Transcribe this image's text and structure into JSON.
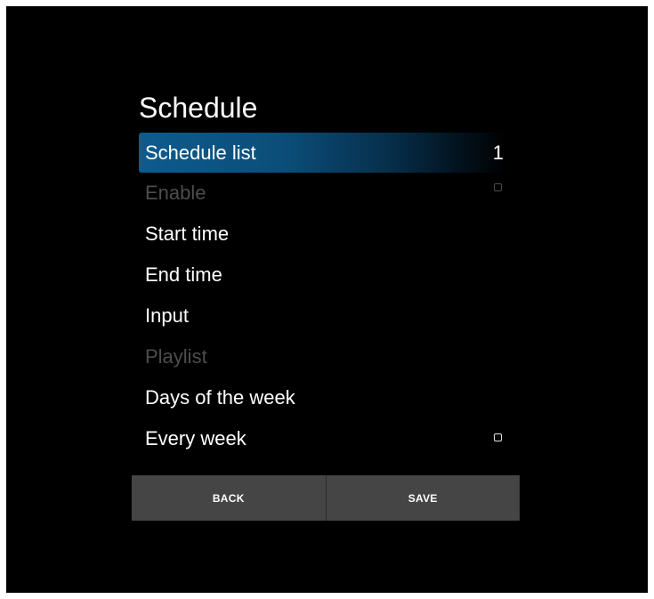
{
  "title": "Schedule",
  "menu": {
    "schedule_list": {
      "label": "Schedule list",
      "value": "1"
    },
    "enable": {
      "label": "Enable"
    },
    "start_time": {
      "label": "Start time"
    },
    "end_time": {
      "label": "End time"
    },
    "input": {
      "label": "Input"
    },
    "playlist": {
      "label": "Playlist"
    },
    "days_of_week": {
      "label": "Days of the week"
    },
    "every_week": {
      "label": "Every week"
    }
  },
  "buttons": {
    "back": "BACK",
    "save": "SAVE"
  },
  "colors": {
    "background": "#000000",
    "selected_highlight": "#0e5b8d",
    "button_bg": "#454545",
    "disabled_text": "#4d4d4d"
  }
}
